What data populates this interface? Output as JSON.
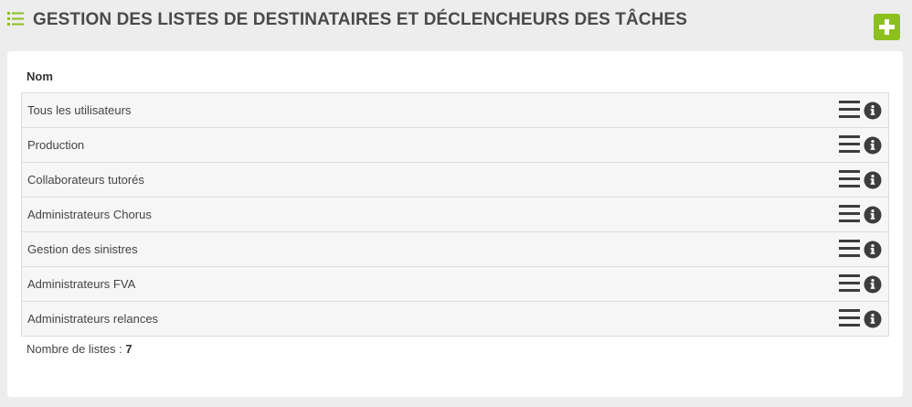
{
  "header": {
    "title": "GESTION DES LISTES DE DESTINATAIRES ET DÉCLENCHEURS DES TÂCHES",
    "title_icon": "list-icon",
    "add_icon": "plus-icon"
  },
  "colors": {
    "accent": "#8cc01e",
    "icon_dark": "#3d3d3d"
  },
  "table": {
    "column_header": "Nom",
    "rows": [
      {
        "name": "Tous les utilisateurs"
      },
      {
        "name": "Production"
      },
      {
        "name": "Collaborateurs tutorés"
      },
      {
        "name": "Administrateurs Chorus"
      },
      {
        "name": "Gestion des sinistres"
      },
      {
        "name": "Administrateurs FVA"
      },
      {
        "name": "Administrateurs relances"
      }
    ],
    "row_actions": [
      "menu-icon",
      "info-icon"
    ]
  },
  "footer": {
    "count_label": "Nombre de listes : ",
    "count_value": "7"
  }
}
